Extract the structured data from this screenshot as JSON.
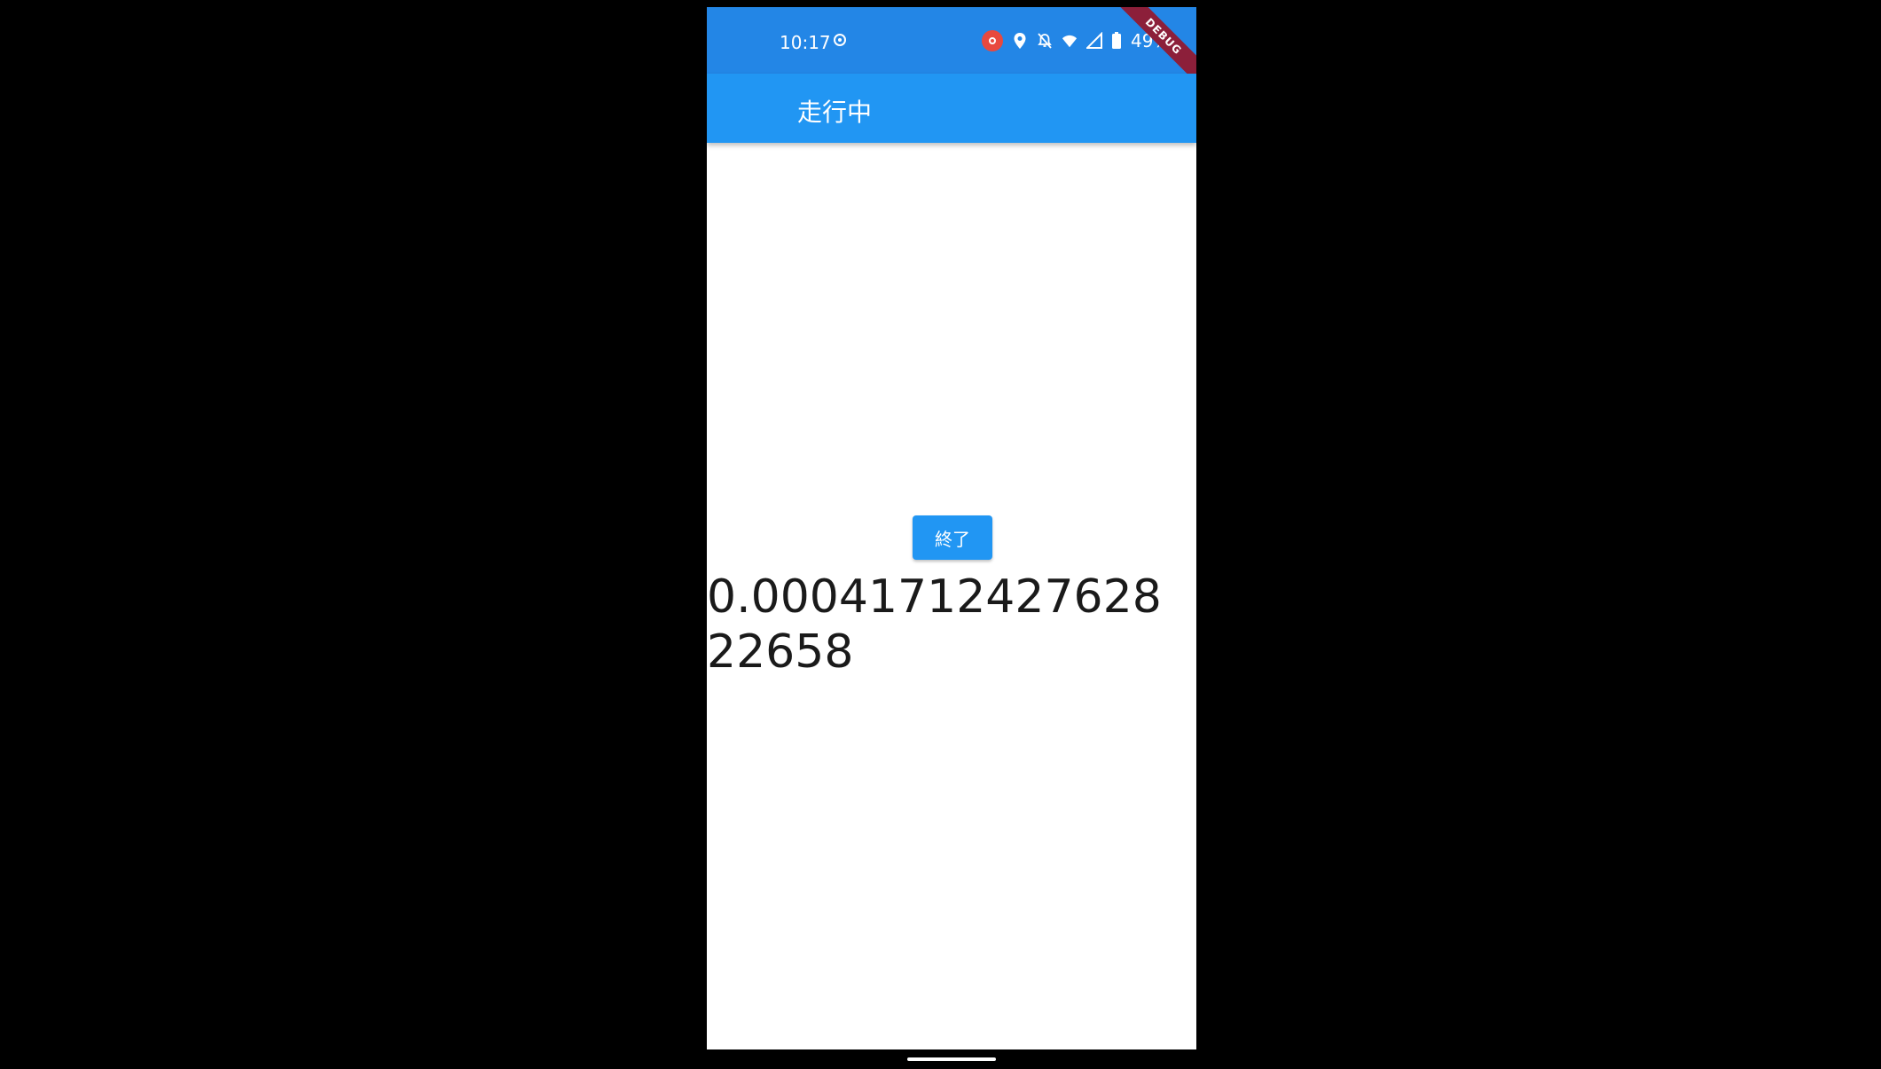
{
  "status_bar": {
    "time": "10:17",
    "battery": "49%",
    "icons": [
      "screen-record-icon",
      "location-icon",
      "bell-off-icon",
      "wifi-icon",
      "signal-icon",
      "battery-icon"
    ]
  },
  "debug_banner": "DEBUG",
  "app_bar": {
    "title": "走行中"
  },
  "main": {
    "end_button_label": "終了",
    "value": "0.0004171242762822658"
  },
  "colors": {
    "primary": "#2196f3",
    "status_bar": "#2386e6",
    "debug_ribbon": "#8c1f3a"
  }
}
